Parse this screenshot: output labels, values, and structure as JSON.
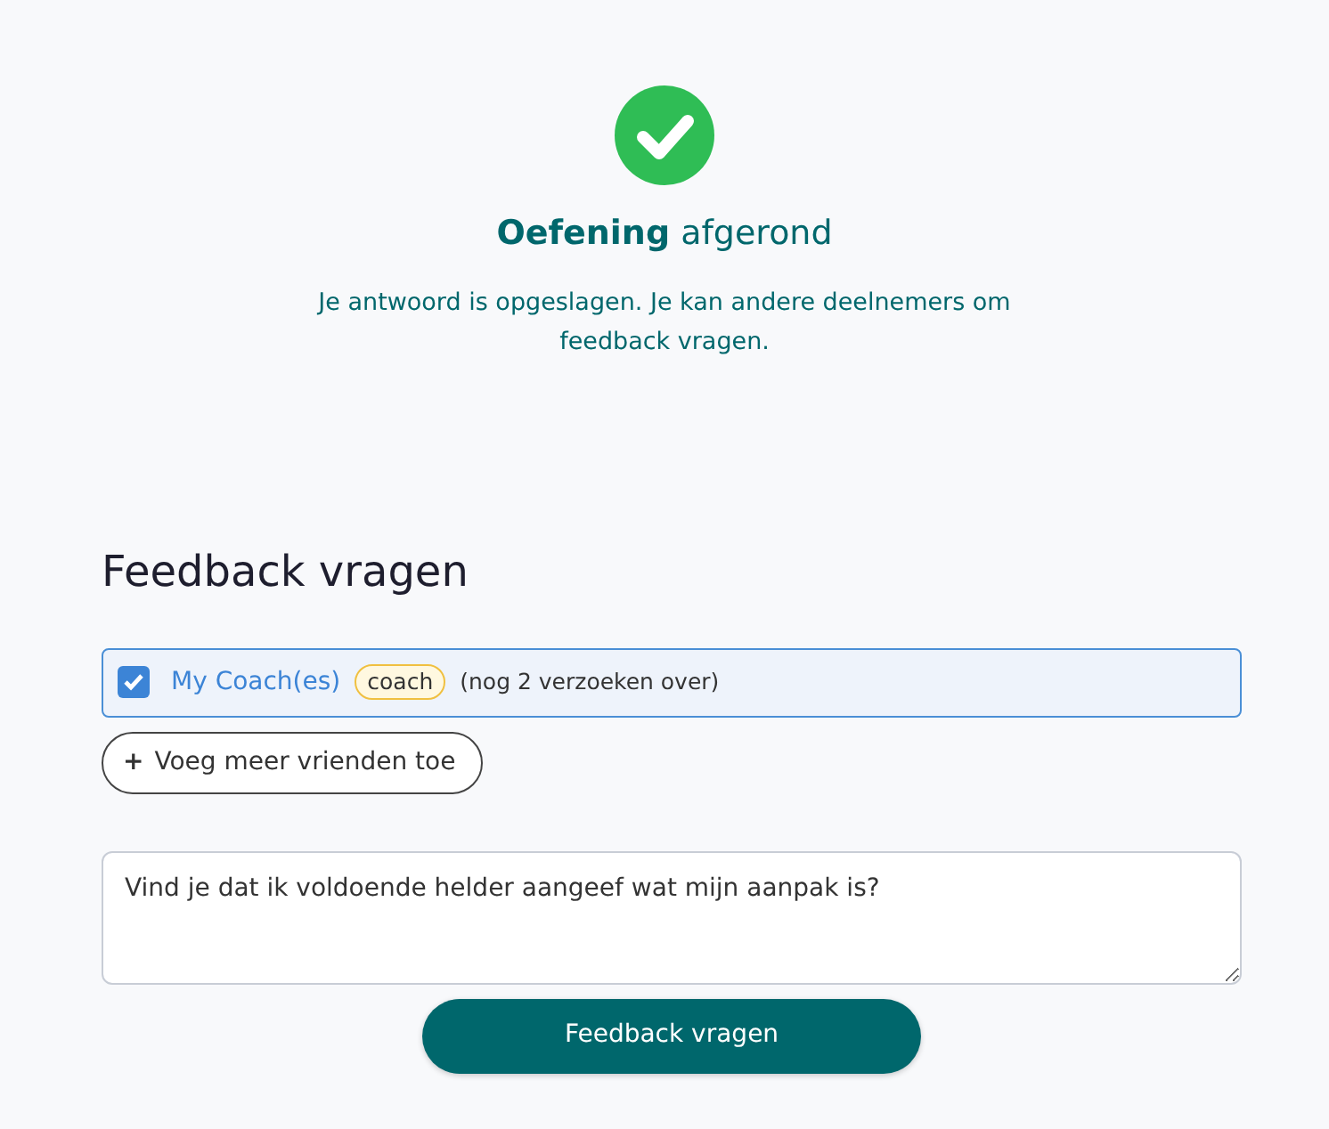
{
  "status": {
    "title": "**Oefening** afgerond",
    "message": "Je antwoord is opgeslagen. Je kan andere deelnemers om feedback vragen."
  },
  "feedback": {
    "heading": "Feedback vragen",
    "recipients": [
      {
        "name": "My Coach(es)",
        "tag": "coach",
        "note": "(nog 2 verzoeken over)",
        "checked": true
      }
    ],
    "add_button": {
      "icon": "+",
      "label": "Voeg meer vrienden toe"
    },
    "question": {
      "value": "Vind je dat ik voldoende helder aangeef wat mijn aanpak is?"
    },
    "submit": "Feedback vragen"
  }
}
